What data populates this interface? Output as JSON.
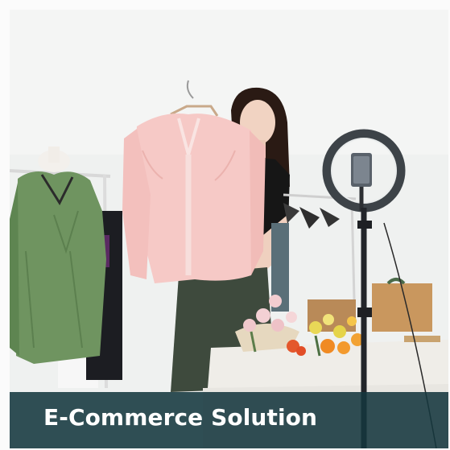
{
  "banner": {
    "caption": "E-Commerce Solution",
    "overlay_color": "#14373e",
    "scene_description_icons": [
      "mannequin-icon",
      "blouse-icon",
      "ring-light-icon",
      "flower-bouquet-icon",
      "clothing-rack-icon"
    ]
  }
}
